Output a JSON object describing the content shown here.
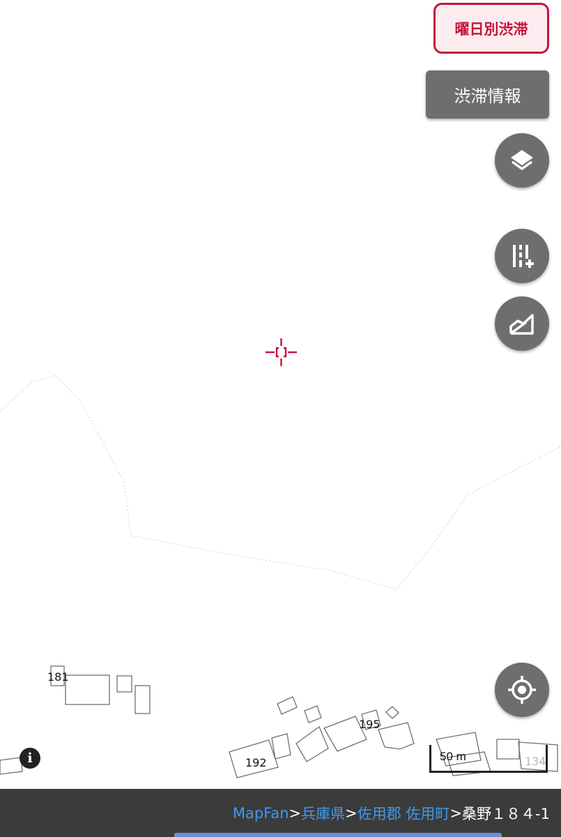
{
  "buttons": {
    "weekday_traffic": "曜日別渋滞",
    "traffic_info": "渋滞情報"
  },
  "icons": {
    "layers": "layers-icon",
    "add_column": "add-column-icon",
    "terrain": "terrain-icon",
    "current_location": "current-location-icon",
    "crosshair": "crosshair-icon",
    "info": "info-icon"
  },
  "info_label": "i",
  "map_labels": {
    "lot_181": "181",
    "lot_195": "195",
    "lot_192": "192",
    "lot_134": "134"
  },
  "scale": {
    "label": "50 m"
  },
  "breadcrumb": {
    "root": "MapFan",
    "prefecture": "兵庫県",
    "district": "佐用郡 佐用町",
    "address": "桑野１８４-1",
    "separator": ">"
  },
  "colors": {
    "accent": "#c3143c",
    "accent_bg": "#fdecef",
    "button_gray": "#6e6e6e",
    "bar_bg": "#3b3b3b",
    "link": "#3f99f0"
  }
}
